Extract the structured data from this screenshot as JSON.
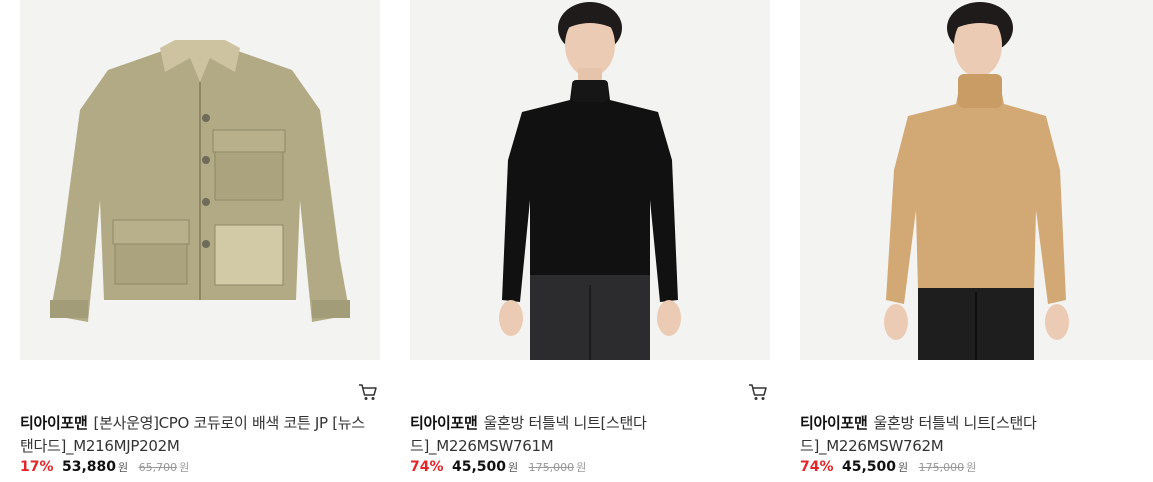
{
  "products": [
    {
      "brand": "티아이포맨",
      "name": "[본사운영]CPO 코듀로이 배색 코튼 JP [뉴스탠다드]_M216MJP202M",
      "discount": "17%",
      "price": "53,880",
      "price_unit": "원",
      "original_price": "65,700",
      "original_unit": "원",
      "image_color": "#b1aa85",
      "cart_icon": "cart-icon"
    },
    {
      "brand": "티아이포맨",
      "name": "울혼방 터틀넥 니트[스탠다드]_M226MSW761M",
      "discount": "74%",
      "price": "45,500",
      "price_unit": "원",
      "original_price": "175,000",
      "original_unit": "원",
      "image_color": "#111111",
      "cart_icon": "cart-icon"
    },
    {
      "brand": "티아이포맨",
      "name": "울혼방 터틀넥 니트[스탠다드]_M226MSW762M",
      "discount": "74%",
      "price": "45,500",
      "price_unit": "원",
      "original_price": "175,000",
      "original_unit": "원",
      "image_color": "#d2a874",
      "cart_icon": "cart-icon"
    }
  ],
  "colors": {
    "discount": "#e4262b",
    "image_bg": "#f3f3f1"
  }
}
